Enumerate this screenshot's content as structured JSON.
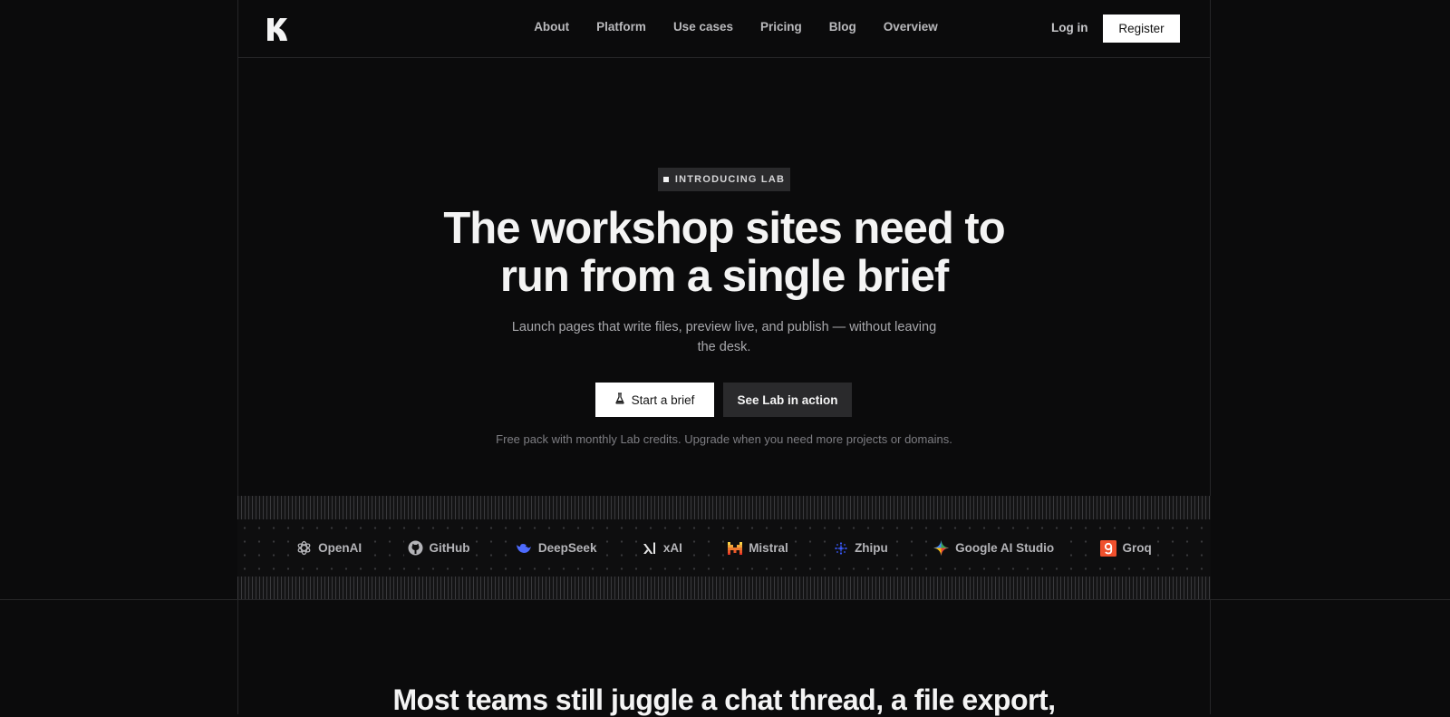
{
  "nav": {
    "links": [
      "About",
      "Platform",
      "Use cases",
      "Pricing",
      "Blog",
      "Overview"
    ],
    "login_label": "Log in",
    "register_label": "Register"
  },
  "hero": {
    "badge": "INTRODUCING LAB",
    "headline_line1": "The workshop sites need to",
    "headline_line2": "run from a single brief",
    "subhead": "Launch pages that write files, preview live, and publish — without leaving the desk.",
    "primary_cta": "Start a brief",
    "secondary_cta": "See Lab in action",
    "note": "Free pack with monthly Lab credits. Upgrade when you need more projects or domains."
  },
  "logos": [
    {
      "name": "OpenAI",
      "icon": "openai-icon"
    },
    {
      "name": "GitHub",
      "icon": "github-icon"
    },
    {
      "name": "DeepSeek",
      "icon": "deepseek-icon"
    },
    {
      "name": "xAI",
      "icon": "xai-icon"
    },
    {
      "name": "Mistral",
      "icon": "mistral-icon"
    },
    {
      "name": "Zhipu",
      "icon": "zhipu-icon"
    },
    {
      "name": "Google AI Studio",
      "icon": "google-ai-studio-icon"
    },
    {
      "name": "Groq",
      "icon": "groq-icon"
    }
  ],
  "section2": {
    "headline": "Most teams still juggle a chat thread, a file export,"
  },
  "colors": {
    "background": "#0b0b0c",
    "button_light": "#ffffff",
    "button_dark": "#2a2a2c",
    "groq_accent": "#f0502d",
    "deepseek_accent": "#4d6bfe",
    "zhipu_accent": "#3a5bff"
  }
}
